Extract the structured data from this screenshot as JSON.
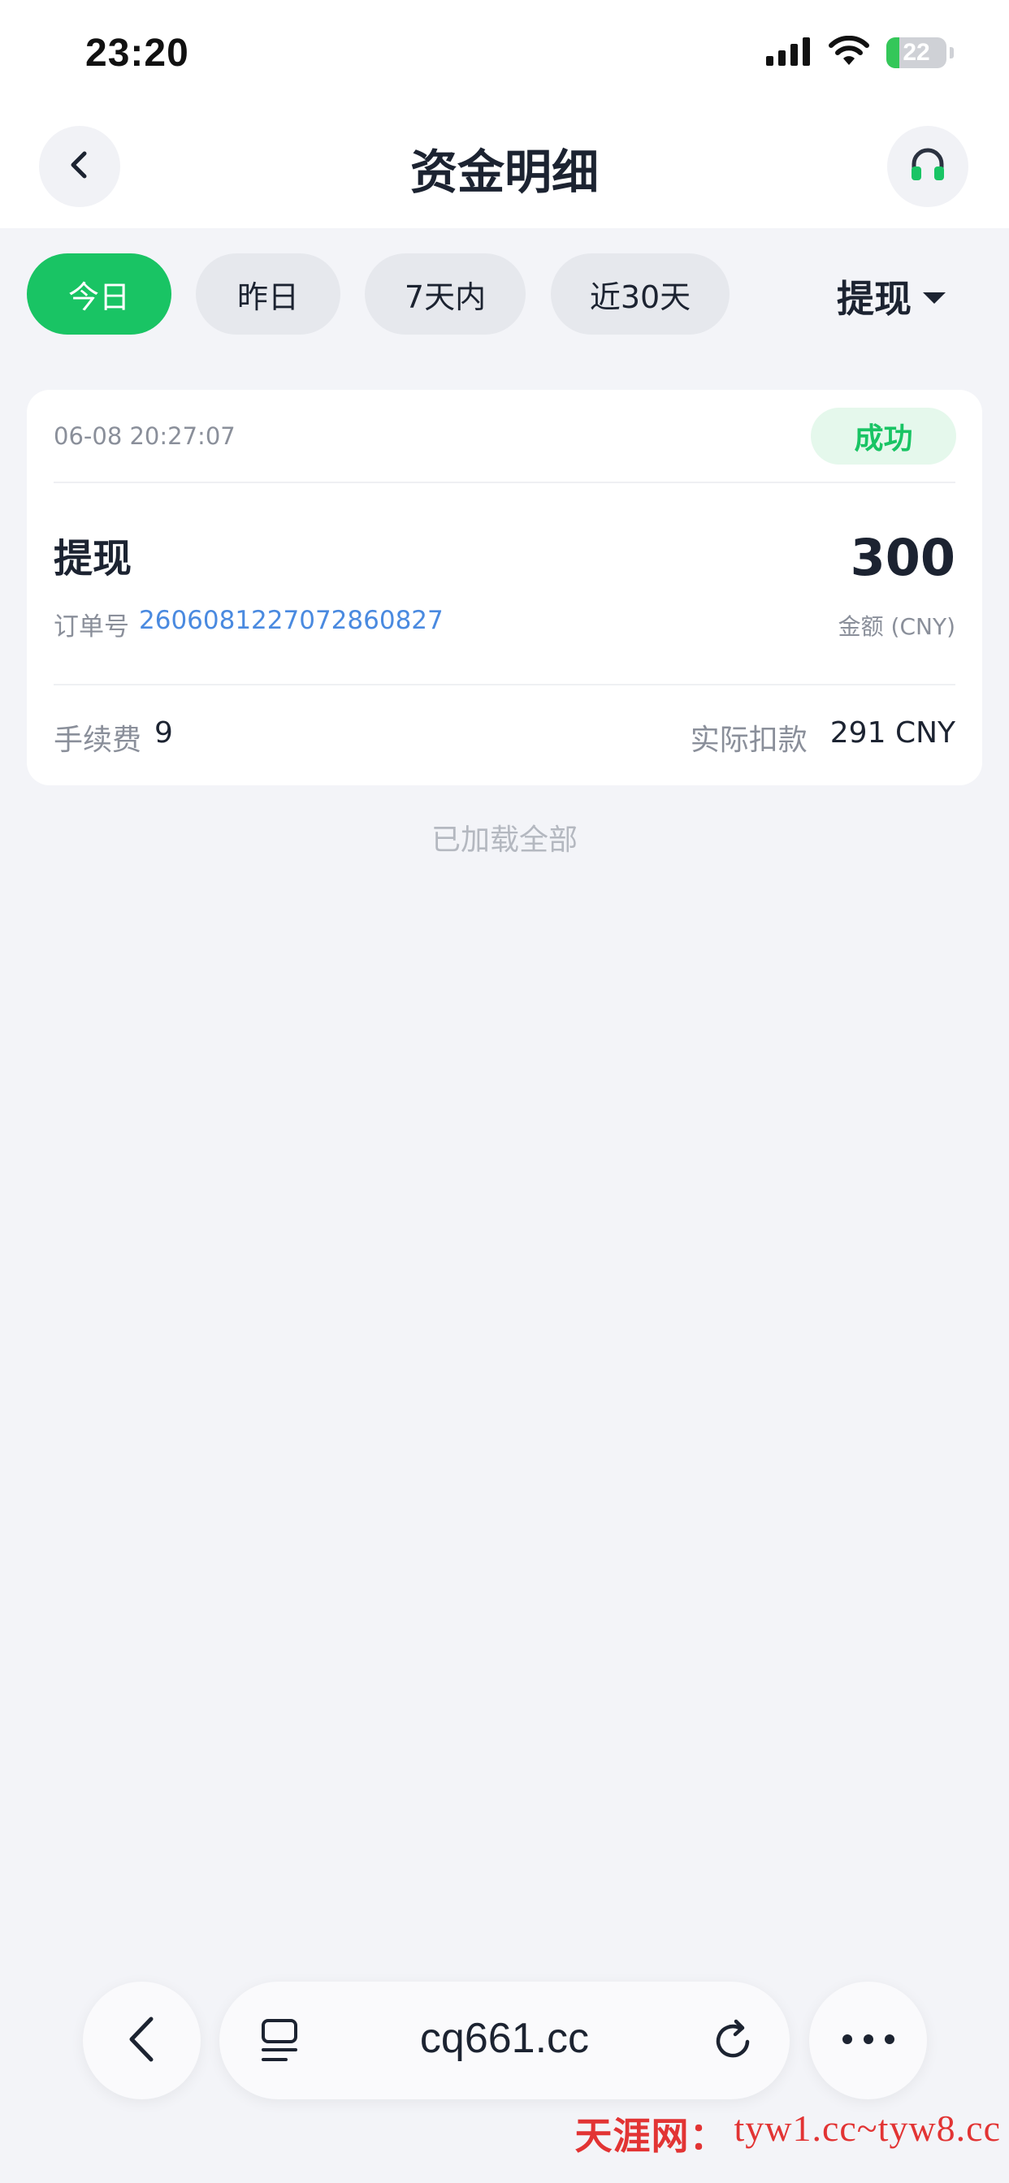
{
  "status_bar": {
    "time": "23:20",
    "battery": "22",
    "battery_level": 0.22,
    "icons": [
      "signal-icon",
      "wifi-icon",
      "battery-charging-icon"
    ]
  },
  "nav": {
    "title": "资金明细",
    "back_icon": "chevron-left-icon",
    "service_icon": "headset-icon"
  },
  "filters": {
    "chips": [
      {
        "label": "今日",
        "active": true
      },
      {
        "label": "昨日",
        "active": false
      },
      {
        "label": "7天内",
        "active": false
      },
      {
        "label": "近30天",
        "active": false
      }
    ],
    "type_select": "提现"
  },
  "record": {
    "time": "06-08 20:27:07",
    "status": "成功",
    "type": "提现",
    "amount": "300",
    "order_label": "订单号",
    "order_no": "2606081227072860827",
    "amount_caption": "金额 (CNY)",
    "fee_label": "手续费",
    "fee_value": "9",
    "deduct_label": "实际扣款",
    "deduct_value": "291 CNY"
  },
  "list_footer": "已加载全部",
  "browser": {
    "url": "cq661.cc",
    "icons": [
      "back-icon",
      "tabs-icon",
      "reload-icon",
      "more-icon"
    ]
  },
  "watermark": {
    "name": "天涯网：",
    "domains": "tyw1.cc~tyw8.cc"
  },
  "colors": {
    "accent": "#19c464",
    "link": "#4a8ae0",
    "background": "#f3f4f8",
    "watermark": "#e23434"
  }
}
